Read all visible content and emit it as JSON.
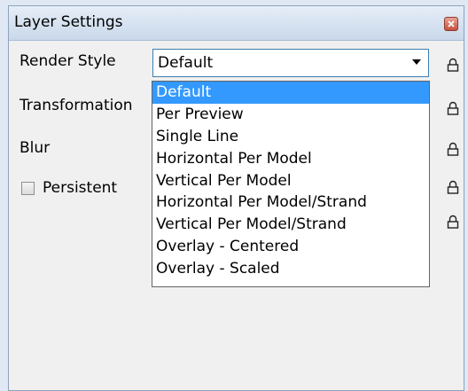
{
  "window": {
    "title": "Layer Settings"
  },
  "fields": {
    "render_style_label": "Render Style",
    "transformation_label": "Transformation",
    "blur_label": "Blur",
    "persistent_label": "Persistent"
  },
  "render_style": {
    "selected": "Default",
    "options": [
      "Default",
      "Per Preview",
      "Single Line",
      "Horizontal Per Model",
      "Vertical Per Model",
      "Horizontal Per Model/Strand",
      "Vertical Per Model/Strand",
      "Overlay - Centered",
      "Overlay - Scaled"
    ],
    "highlighted_index": 0
  },
  "persistent_checked": false,
  "lock_icons": [
    "lock-icon",
    "lock-icon",
    "lock-icon",
    "lock-icon",
    "lock-icon"
  ],
  "colors": {
    "selection": "#3399ff",
    "combo_border": "#3c7fb1",
    "close_button": "#c6503c"
  }
}
